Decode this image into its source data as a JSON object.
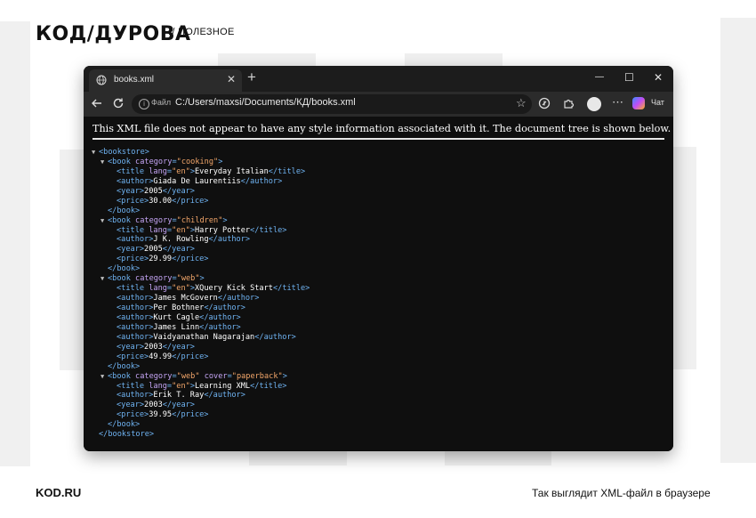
{
  "site": {
    "logo_text": "КОД/ДУРОВА",
    "tagline": "// ПОЛЕЗНОЕ",
    "footer_left": "KOD.RU",
    "footer_right": "Так выглядит XML-файл в браузере"
  },
  "browser": {
    "tab_title": "books.xml",
    "tab_close": "✕",
    "new_tab": "+",
    "win_minimize": "—",
    "win_maximize": "☐",
    "win_close": "✕",
    "address_label": "Файл",
    "address_url": "C:/Users/maxsi/Documents/КД/books.xml",
    "chat_label": "Чат",
    "icons": [
      "globe-icon",
      "back-icon",
      "refresh-icon",
      "info-icon",
      "star-icon",
      "extensions-icon",
      "puzzle-icon",
      "profile-icon",
      "more-icon",
      "copilot-icon"
    ]
  },
  "page": {
    "notice": "This XML file does not appear to have any style information associated with it. The document tree is shown below."
  },
  "xml": {
    "lines": [
      {
        "indent": 0,
        "toggle": true,
        "open": "<bookstore>"
      },
      {
        "indent": 1,
        "toggle": true,
        "open_name": "<book ",
        "attrs": [
          [
            "category",
            "\"cooking\""
          ]
        ],
        "open_end": ">"
      },
      {
        "indent": 2,
        "open_name": "<title ",
        "attrs": [
          [
            "lang",
            "\"en\""
          ]
        ],
        "open_end": ">",
        "text": "Everyday Italian",
        "close": "</title>"
      },
      {
        "indent": 2,
        "open": "<author>",
        "text": "Giada De Laurentiis",
        "close": "</author>"
      },
      {
        "indent": 2,
        "open": "<year>",
        "text": "2005",
        "close": "</year>"
      },
      {
        "indent": 2,
        "open": "<price>",
        "text": "30.00",
        "close": "</price>"
      },
      {
        "indent": 1,
        "close": "</book>"
      },
      {
        "indent": 1,
        "toggle": true,
        "open_name": "<book ",
        "attrs": [
          [
            "category",
            "\"children\""
          ]
        ],
        "open_end": ">"
      },
      {
        "indent": 2,
        "open_name": "<title ",
        "attrs": [
          [
            "lang",
            "\"en\""
          ]
        ],
        "open_end": ">",
        "text": "Harry Potter",
        "close": "</title>"
      },
      {
        "indent": 2,
        "open": "<author>",
        "text": "J K. Rowling",
        "close": "</author>"
      },
      {
        "indent": 2,
        "open": "<year>",
        "text": "2005",
        "close": "</year>"
      },
      {
        "indent": 2,
        "open": "<price>",
        "text": "29.99",
        "close": "</price>"
      },
      {
        "indent": 1,
        "close": "</book>"
      },
      {
        "indent": 1,
        "toggle": true,
        "open_name": "<book ",
        "attrs": [
          [
            "category",
            "\"web\""
          ]
        ],
        "open_end": ">"
      },
      {
        "indent": 2,
        "open_name": "<title ",
        "attrs": [
          [
            "lang",
            "\"en\""
          ]
        ],
        "open_end": ">",
        "text": "XQuery Kick Start",
        "close": "</title>"
      },
      {
        "indent": 2,
        "open": "<author>",
        "text": "James McGovern",
        "close": "</author>"
      },
      {
        "indent": 2,
        "open": "<author>",
        "text": "Per Bothner",
        "close": "</author>"
      },
      {
        "indent": 2,
        "open": "<author>",
        "text": "Kurt Cagle",
        "close": "</author>"
      },
      {
        "indent": 2,
        "open": "<author>",
        "text": "James Linn",
        "close": "</author>"
      },
      {
        "indent": 2,
        "open": "<author>",
        "text": "Vaidyanathan Nagarajan",
        "close": "</author>"
      },
      {
        "indent": 2,
        "open": "<year>",
        "text": "2003",
        "close": "</year>"
      },
      {
        "indent": 2,
        "open": "<price>",
        "text": "49.99",
        "close": "</price>"
      },
      {
        "indent": 1,
        "close": "</book>"
      },
      {
        "indent": 1,
        "toggle": true,
        "open_name": "<book ",
        "attrs": [
          [
            "category",
            "\"web\""
          ],
          [
            "cover",
            "\"paperback\""
          ]
        ],
        "open_end": ">"
      },
      {
        "indent": 2,
        "open_name": "<title ",
        "attrs": [
          [
            "lang",
            "\"en\""
          ]
        ],
        "open_end": ">",
        "text": "Learning XML",
        "close": "</title>"
      },
      {
        "indent": 2,
        "open": "<author>",
        "text": "Erik T. Ray",
        "close": "</author>"
      },
      {
        "indent": 2,
        "open": "<year>",
        "text": "2003",
        "close": "</year>"
      },
      {
        "indent": 2,
        "open": "<price>",
        "text": "39.95",
        "close": "</price>"
      },
      {
        "indent": 1,
        "close": "</book>"
      },
      {
        "indent": 0,
        "close": "</bookstore>"
      }
    ]
  }
}
